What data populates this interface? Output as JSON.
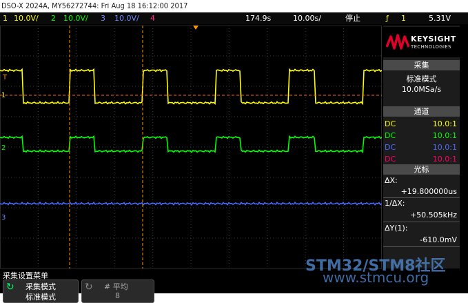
{
  "window": {
    "title": "DSO-X 2024A, MY56272744: Fri Aug 18 16:12:00 2017"
  },
  "status": {
    "ch1_num": "1",
    "ch1_scale": "10.0V/",
    "ch2_num": "2",
    "ch2_scale": "10.0V/",
    "ch3_num": "3",
    "ch3_scale": "10.0V/",
    "ch4_num": "4",
    "trigger_pos": "174.9s",
    "timebase": "10.00s/",
    "run_state": "停止",
    "trig_source": "1",
    "trig_level": "5.31V"
  },
  "brand": {
    "name": "KEYSIGHT",
    "sub": "TECHNOLOGIES"
  },
  "acquire": {
    "heading": "采集",
    "mode": "标准模式",
    "rate": "10.0MSa/s"
  },
  "channels": {
    "heading": "通道",
    "rows": [
      {
        "coupling": "DC",
        "probe": "10.0:1",
        "color": "#ffff00"
      },
      {
        "coupling": "DC",
        "probe": "10.0:1",
        "color": "#00ff00"
      },
      {
        "coupling": "DC",
        "probe": "10.0:1",
        "color": "#4a6bff"
      },
      {
        "coupling": "DC",
        "probe": "10.0:1",
        "color": "#ff0066"
      }
    ]
  },
  "cursors": {
    "heading": "光标",
    "dx_label": "ΔX:",
    "dx_value": "+19.800000us",
    "inv_label": "1/ΔX:",
    "inv_value": "+50.505kHz",
    "dy_label": "ΔY(1):",
    "dy_value": "-610.0mV"
  },
  "markers": {
    "ch1": "1",
    "ch2": "2",
    "ch3": "3",
    "trig": "T"
  },
  "menu": {
    "title": "采集设置菜单",
    "key1_title": "采集模式",
    "key1_value": "标准模式",
    "key2_title": "# 平均",
    "key2_value": "8"
  },
  "watermark": {
    "line1": "STM32/STM8社区",
    "line2": "www.stmcu.org"
  },
  "colors": {
    "ch1": "#ffff00",
    "ch2": "#00ff00",
    "ch3": "#4a6bff",
    "ch4": "#ff0066",
    "cursor": "#ff9900",
    "trig_line": "#ff6600"
  }
}
